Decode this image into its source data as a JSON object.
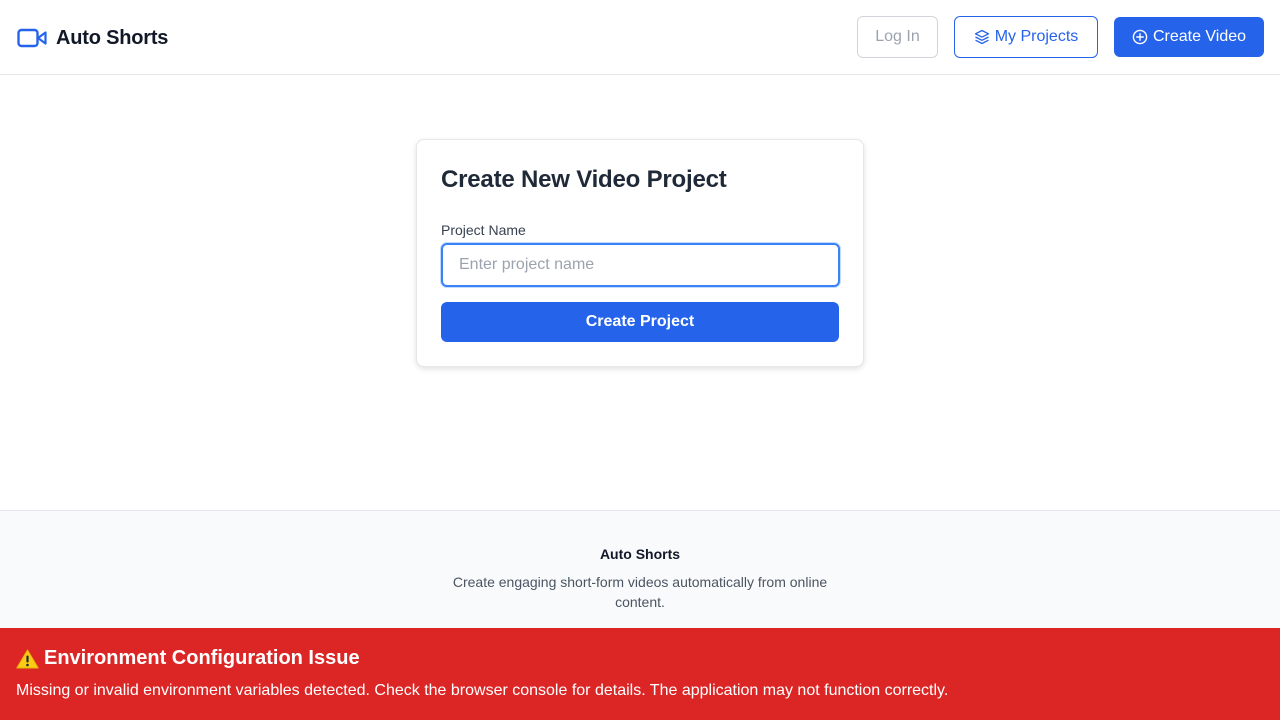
{
  "header": {
    "brand_name": "Auto Shorts",
    "brand_icon": "video-camera-icon",
    "nav": {
      "login_label": "Log In",
      "projects_label": "My Projects",
      "projects_icon": "layers-icon",
      "create_video_label": "Create Video",
      "create_video_icon": "plus-circle-icon"
    }
  },
  "card": {
    "title": "Create New Video Project",
    "project_name_label": "Project Name",
    "project_name_value": "",
    "project_name_placeholder": "Enter project name",
    "submit_label": "Create Project"
  },
  "footer": {
    "title": "Auto Shorts",
    "description": "Create engaging short-form videos automatically from online content."
  },
  "banner": {
    "icon": "warning-icon",
    "title": "Environment Configuration Issue",
    "message": "Missing or invalid environment variables detected. Check the browser console for details. The application may not function correctly."
  },
  "colors": {
    "primary": "#2563eb",
    "error_banner": "#dc2626",
    "border": "#e5e7eb",
    "footer_bg": "#f9fafb"
  }
}
